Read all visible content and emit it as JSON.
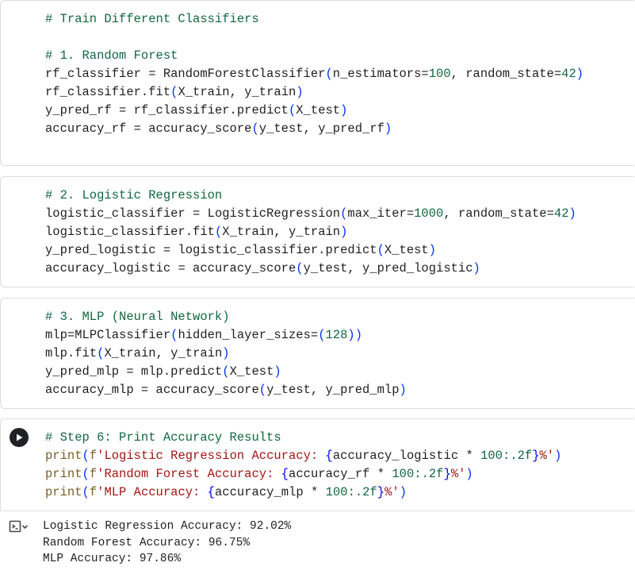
{
  "cells": [
    {
      "lines": [
        "# Train Different Classifiers",
        "",
        "# 1. Random Forest",
        "rf_classifier = RandomForestClassifier(n_estimators=100, random_state=42)",
        "rf_classifier.fit(X_train, y_train)",
        "y_pred_rf = rf_classifier.predict(X_test)",
        "accuracy_rf = accuracy_score(y_test, y_pred_rf)"
      ]
    },
    {
      "lines": [
        "# 2. Logistic Regression",
        "logistic_classifier = LogisticRegression(max_iter=1000, random_state=42)",
        "logistic_classifier.fit(X_train, y_train)",
        "y_pred_logistic = logistic_classifier.predict(X_test)",
        "accuracy_logistic = accuracy_score(y_test, y_pred_logistic)"
      ]
    },
    {
      "lines": [
        "# 3. MLP (Neural Network)",
        "mlp=MLPClassifier(hidden_layer_sizes=(128))",
        "mlp.fit(X_train, y_train)",
        "y_pred_mlp = mlp.predict(X_test)",
        "accuracy_mlp = accuracy_score(y_test, y_pred_mlp)"
      ]
    },
    {
      "lines": [
        "# Step 6: Print Accuracy Results",
        "print(f'Logistic Regression Accuracy: {accuracy_logistic * 100:.2f}%')",
        "print(f'Random Forest Accuracy: {accuracy_rf * 100:.2f}%')",
        "print(f'MLP Accuracy: {accuracy_mlp * 100:.2f}%')"
      ]
    }
  ],
  "output": {
    "lines": [
      "Logistic Regression Accuracy: 92.02%",
      "Random Forest Accuracy: 96.75%",
      "MLP Accuracy: 97.86%"
    ]
  },
  "icons": {
    "run": "play-icon",
    "output": "output-toggle-icon"
  }
}
